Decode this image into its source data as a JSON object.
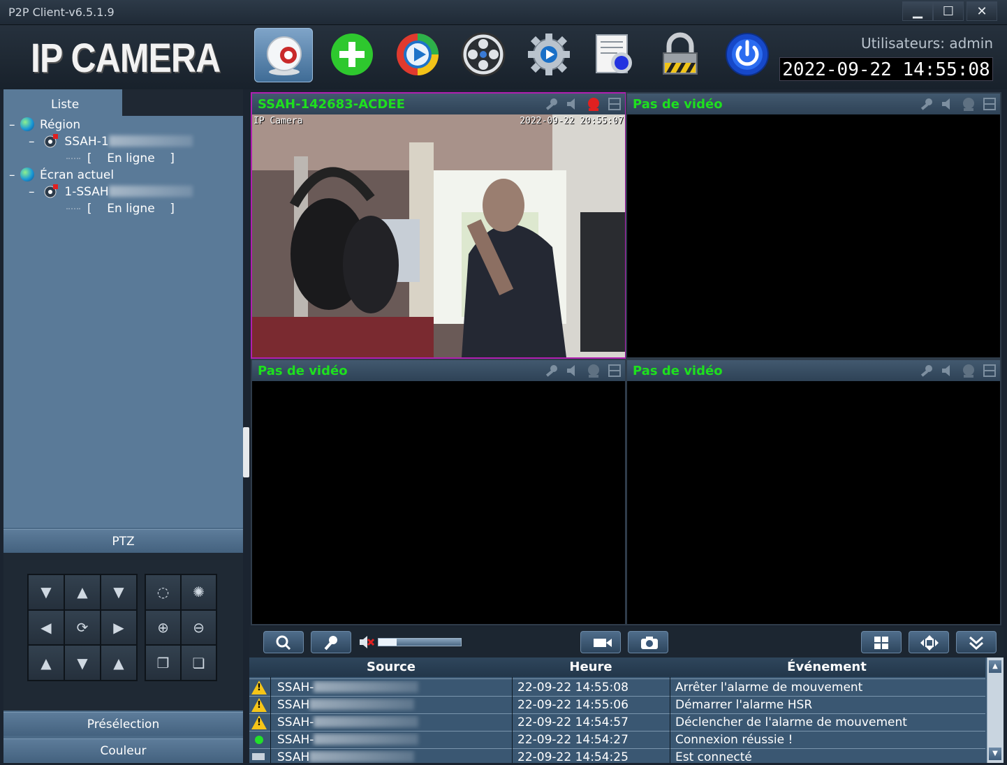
{
  "window": {
    "title": "P2P Client-v6.5.1.9",
    "min": "▁",
    "max": "☐",
    "close": "✕"
  },
  "header": {
    "logo": "IP CAMERA",
    "user_label": "Utilisateurs: admin",
    "datetime": "2022-09-22  14:55:08",
    "tools": [
      "camera-icon",
      "add-icon",
      "playback-icon",
      "ptz-reel-icon",
      "settings-icon",
      "log-icon",
      "lock-icon",
      "power-icon"
    ]
  },
  "sidebar": {
    "tab_list": "Liste",
    "tree": [
      {
        "label": "Région",
        "type": "group"
      },
      {
        "label": "SSAH-1",
        "type": "device"
      },
      {
        "status_open": "[",
        "status": "En ligne",
        "status_close": "]"
      },
      {
        "label": "Écran actuel",
        "type": "group"
      },
      {
        "label": "1-SSAH",
        "type": "device"
      },
      {
        "status_open": "[",
        "status": "En ligne",
        "status_close": "]"
      }
    ],
    "ptz_label": "PTZ",
    "preset_label": "Présélection",
    "color_label": "Couleur"
  },
  "video": {
    "cells": [
      {
        "title": "SSAH-142683-ACDEE",
        "osd_left": "IP Camera",
        "osd_right": "2022-09-22 20:55:07",
        "selected": true
      },
      {
        "title": "Pas de vidéo"
      },
      {
        "title": "Pas de vidéo"
      },
      {
        "title": "Pas de vidéo"
      }
    ]
  },
  "controls": {
    "volume_fraction": 0.22
  },
  "events": {
    "columns": [
      "Source",
      "Heure",
      "Événement"
    ],
    "rows": [
      {
        "icon": "warning-icon",
        "source": "SSAH-",
        "time": "22-09-22 14:55:08",
        "event": "Arrêter l'alarme de mouvement"
      },
      {
        "icon": "warning-icon",
        "source": "SSAH",
        "time": "22-09-22 14:55:06",
        "event": "Démarrer l'alarme HSR"
      },
      {
        "icon": "warning-icon",
        "source": "SSAH-",
        "time": "22-09-22 14:54:57",
        "event": "Déclencher de l'alarme de mouvement"
      },
      {
        "icon": "online-dot-icon",
        "source": "SSAH-",
        "time": "22-09-22 14:54:27",
        "event": "Connexion réussie !"
      },
      {
        "icon": "connected-icon",
        "source": "SSAH",
        "time": "22-09-22 14:54:25",
        "event": "Est connecté"
      }
    ]
  },
  "colors": {
    "accent_green": "#1ee01e",
    "selected_border": "#b01fb0",
    "panel_blue": "#5a7a98"
  }
}
